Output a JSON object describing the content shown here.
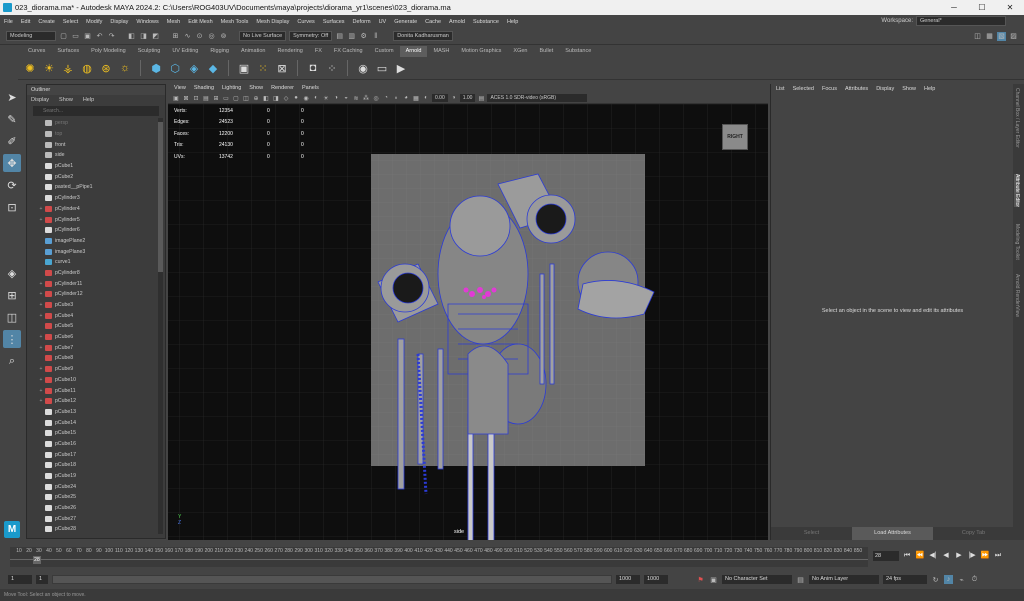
{
  "window": {
    "title": "023_diorama.ma* - Autodesk MAYA 2024.2: C:\\Users\\ROG403UV\\Documents\\maya\\projects\\diorama_yr1\\scenes\\023_diorama.ma",
    "minimize": "─",
    "maximize": "☐",
    "close": "✕"
  },
  "menubar": {
    "items": [
      "File",
      "Edit",
      "Create",
      "Select",
      "Modify",
      "Display",
      "Windows",
      "Mesh",
      "Edit Mesh",
      "Mesh Tools",
      "Mesh Display",
      "Curves",
      "Surfaces",
      "Deform",
      "UV",
      "Generate",
      "Cache",
      "Arnold",
      "Substance",
      "Help"
    ],
    "workspace_label": "Workspace:",
    "workspace_value": "General*"
  },
  "statusline": {
    "menuset": "Modeling",
    "live_surface": "No Live Surface",
    "symmetry": "Symmetry: Off",
    "user": "Donita Kadharusman"
  },
  "shelf": {
    "tabs": [
      "Curves",
      "Surfaces",
      "Poly Modeling",
      "Sculpting",
      "UV Editing",
      "Rigging",
      "Animation",
      "Rendering",
      "FX",
      "FX Caching",
      "Custom",
      "Arnold",
      "MASH",
      "Motion Graphics",
      "XGen",
      "Bullet",
      "Substance"
    ],
    "active_tab": "Arnold"
  },
  "outliner": {
    "title": "Outliner",
    "menu": [
      "Display",
      "Show",
      "Help"
    ],
    "search_placeholder": "Search...",
    "items": [
      {
        "label": "persp",
        "type": "camera",
        "dim": true,
        "expand": ""
      },
      {
        "label": "top",
        "type": "camera",
        "dim": true,
        "expand": ""
      },
      {
        "label": "front",
        "type": "camera",
        "dim": false,
        "expand": ""
      },
      {
        "label": "side",
        "type": "camera",
        "dim": false,
        "expand": ""
      },
      {
        "label": "pCube1",
        "type": "mesh",
        "dim": false,
        "expand": ""
      },
      {
        "label": "pCube2",
        "type": "mesh",
        "dim": false,
        "expand": ""
      },
      {
        "label": "pasted__pPipe1",
        "type": "mesh",
        "dim": false,
        "expand": ""
      },
      {
        "label": "pCylinder3",
        "type": "mesh",
        "dim": false,
        "expand": ""
      },
      {
        "label": "pCylinder4",
        "type": "mesh-red",
        "dim": false,
        "expand": "+"
      },
      {
        "label": "pCylinder5",
        "type": "mesh-red",
        "dim": false,
        "expand": "+"
      },
      {
        "label": "pCylinder6",
        "type": "mesh",
        "dim": false,
        "expand": ""
      },
      {
        "label": "imagePlane2",
        "type": "image",
        "dim": false,
        "expand": ""
      },
      {
        "label": "imagePlane3",
        "type": "image",
        "dim": false,
        "expand": ""
      },
      {
        "label": "curve1",
        "type": "curve",
        "dim": false,
        "expand": ""
      },
      {
        "label": "pCylinder8",
        "type": "mesh-red",
        "dim": false,
        "expand": ""
      },
      {
        "label": "pCylinder11",
        "type": "mesh-red",
        "dim": false,
        "expand": "+"
      },
      {
        "label": "pCylinder12",
        "type": "mesh-red",
        "dim": false,
        "expand": "+"
      },
      {
        "label": "pCube3",
        "type": "mesh-red",
        "dim": false,
        "expand": "+"
      },
      {
        "label": "pCube4",
        "type": "mesh-red",
        "dim": false,
        "expand": "+"
      },
      {
        "label": "pCube5",
        "type": "mesh-red",
        "dim": false,
        "expand": ""
      },
      {
        "label": "pCube6",
        "type": "mesh-red",
        "dim": false,
        "expand": "+"
      },
      {
        "label": "pCube7",
        "type": "mesh-red",
        "dim": false,
        "expand": "+"
      },
      {
        "label": "pCube8",
        "type": "mesh-red",
        "dim": false,
        "expand": ""
      },
      {
        "label": "pCube9",
        "type": "mesh-red",
        "dim": false,
        "expand": "+"
      },
      {
        "label": "pCube10",
        "type": "mesh-red",
        "dim": false,
        "expand": "+"
      },
      {
        "label": "pCube11",
        "type": "mesh-red",
        "dim": false,
        "expand": "+"
      },
      {
        "label": "pCube12",
        "type": "mesh-red",
        "dim": false,
        "expand": "+"
      },
      {
        "label": "pCube13",
        "type": "mesh",
        "dim": false,
        "expand": ""
      },
      {
        "label": "pCube14",
        "type": "mesh",
        "dim": false,
        "expand": ""
      },
      {
        "label": "pCube15",
        "type": "mesh",
        "dim": false,
        "expand": ""
      },
      {
        "label": "pCube16",
        "type": "mesh",
        "dim": false,
        "expand": ""
      },
      {
        "label": "pCube17",
        "type": "mesh",
        "dim": false,
        "expand": ""
      },
      {
        "label": "pCube18",
        "type": "mesh",
        "dim": false,
        "expand": ""
      },
      {
        "label": "pCube19",
        "type": "mesh",
        "dim": false,
        "expand": ""
      },
      {
        "label": "pCube24",
        "type": "mesh",
        "dim": false,
        "expand": ""
      },
      {
        "label": "pCube25",
        "type": "mesh",
        "dim": false,
        "expand": ""
      },
      {
        "label": "pCube26",
        "type": "mesh",
        "dim": false,
        "expand": ""
      },
      {
        "label": "pCube27",
        "type": "mesh",
        "dim": false,
        "expand": ""
      },
      {
        "label": "pCube28",
        "type": "mesh",
        "dim": false,
        "expand": ""
      }
    ]
  },
  "viewport": {
    "menu": [
      "View",
      "Shading",
      "Lighting",
      "Show",
      "Renderer",
      "Panels"
    ],
    "near_value": "0.00",
    "far_value": "1.00",
    "color_space": "ACES 1.0 SDR-video (sRGB)",
    "viewcube_label": "RIGHT",
    "camera_label": "side",
    "axis_y": "Y",
    "axis_z": "Z",
    "hud": [
      {
        "label": "Verts:",
        "v1": "12354",
        "v2": "0",
        "v3": "0"
      },
      {
        "label": "Edges:",
        "v1": "24523",
        "v2": "0",
        "v3": "0"
      },
      {
        "label": "Faces:",
        "v1": "12200",
        "v2": "0",
        "v3": "0"
      },
      {
        "label": "Tris:",
        "v1": "24130",
        "v2": "0",
        "v3": "0"
      },
      {
        "label": "UVs:",
        "v1": "13742",
        "v2": "0",
        "v3": "0"
      }
    ],
    "colors": {
      "wire": "#2b3bd6",
      "highlight": "#e23ad6",
      "mesh": "#8f8f8f"
    }
  },
  "attribute_editor": {
    "menu": [
      "List",
      "Selected",
      "Focus",
      "Attributes",
      "Display",
      "Show",
      "Help"
    ],
    "message": "Select an object in the scene to view and edit its attributes",
    "buttons": [
      "Select",
      "Load Attributes",
      "Copy Tab"
    ]
  },
  "side_tabs": [
    "Channel Box / Layer Editor",
    "Attribute Editor",
    "Modeling Toolkit",
    "Arnold RenderView"
  ],
  "timeline": {
    "ticks": [
      "10",
      "20",
      "30",
      "40",
      "50",
      "60",
      "70",
      "80",
      "90",
      "100",
      "110",
      "120",
      "130",
      "140",
      "150",
      "160",
      "170",
      "180",
      "190",
      "200",
      "210",
      "220",
      "230",
      "240",
      "250",
      "260",
      "270",
      "280",
      "290",
      "300",
      "310",
      "320",
      "330",
      "340",
      "350",
      "360",
      "370",
      "380",
      "390",
      "400",
      "410",
      "420",
      "430",
      "440",
      "450",
      "460",
      "470",
      "480",
      "490",
      "500",
      "510",
      "520",
      "530",
      "540",
      "550",
      "560",
      "570",
      "580",
      "590",
      "600",
      "610",
      "620",
      "630",
      "640",
      "650",
      "660",
      "670",
      "680",
      "690",
      "700",
      "710",
      "720",
      "730",
      "740",
      "750",
      "760",
      "770",
      "780",
      "790",
      "800",
      "810",
      "820",
      "830",
      "840",
      "850"
    ],
    "playhead": "28",
    "current_frame": "28"
  },
  "range": {
    "start": "1",
    "inner_start": "1",
    "inner_end": "1000",
    "end": "1000",
    "character_set": "No Character Set",
    "anim_layer": "No Anim Layer",
    "fps": "24 fps"
  },
  "help_line": "Move Tool: Select an object to move."
}
